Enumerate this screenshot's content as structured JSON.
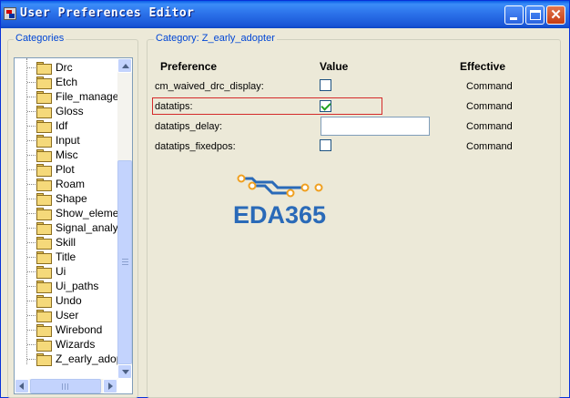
{
  "window": {
    "title": "User Preferences Editor",
    "icon": "app-icon"
  },
  "categories": {
    "group_label": "Categories",
    "items": [
      "Drc",
      "Etch",
      "File_managem",
      "Gloss",
      "Idf",
      "Input",
      "Misc",
      "Plot",
      "Roam",
      "Shape",
      "Show_elemen",
      "Signal_analysi",
      "Skill",
      "Title",
      "Ui",
      "Ui_paths",
      "Undo",
      "User",
      "Wirebond",
      "Wizards",
      "Z_early_adopt"
    ]
  },
  "panel": {
    "group_label": "Category:  Z_early_adopter",
    "columns": {
      "preference": "Preference",
      "value": "Value",
      "effective": "Effective"
    },
    "rows": [
      {
        "name": "cm_waived_drc_display:",
        "control": "checkbox",
        "checked": false,
        "effective": "Command"
      },
      {
        "name": "datatips:",
        "control": "checkbox",
        "checked": true,
        "effective": "Command",
        "highlighted": true
      },
      {
        "name": "datatips_delay:",
        "control": "text",
        "value": "",
        "effective": "Command"
      },
      {
        "name": "datatips_fixedpos:",
        "control": "checkbox",
        "checked": false,
        "effective": "Command"
      }
    ]
  },
  "watermark": {
    "text": "EDA365"
  },
  "colors": {
    "accent": "#0046d5",
    "highlight": "#d42a2a",
    "check": "#21a121",
    "logo_text": "#2a6ab8",
    "logo_trace": "#2a6ab8",
    "logo_node": "#f0a020"
  }
}
